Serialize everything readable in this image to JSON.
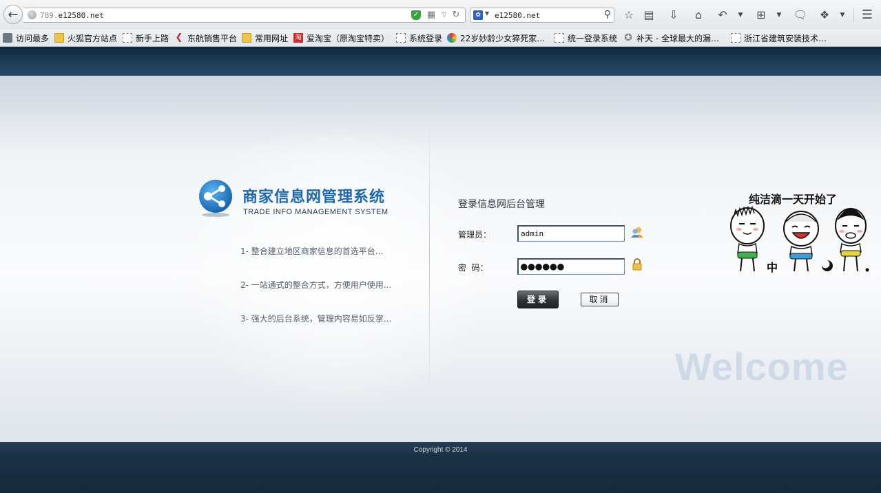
{
  "browser": {
    "url": {
      "host_dim": "789.",
      "host": "e12580.net"
    },
    "search": {
      "engine_icon": "baidu-paw-icon",
      "query": "e12580.net"
    },
    "bookmarks": [
      {
        "label": "访问最多",
        "icon": "most-visited-icon"
      },
      {
        "label": "火狐官方站点",
        "icon": "folder-icon"
      },
      {
        "label": "新手上路",
        "icon": "page-icon"
      },
      {
        "label": "东航销售平台",
        "icon": "airline-icon"
      },
      {
        "label": "常用网址",
        "icon": "folder-icon"
      },
      {
        "label": "爱淘宝（原淘宝特卖）",
        "icon": "taobao-icon"
      },
      {
        "label": "系统登录",
        "icon": "page-icon"
      },
      {
        "label": "22岁妙龄少女猝死家…",
        "icon": "swirl-icon"
      },
      {
        "label": "统一登录系统",
        "icon": "page-icon"
      },
      {
        "label": "补天 - 全球最大的漏…",
        "icon": "star-icon"
      },
      {
        "label": "浙江省建筑安装技术…",
        "icon": "page-icon"
      }
    ]
  },
  "brand": {
    "title": "商家信息网管理系统",
    "subtitle": "TRADE INFO MANAGEMENT SYSTEM"
  },
  "features": [
    "1- 整合建立地区商家信息的首选平台...",
    "2- 一站通式的整合方式，方便用户使用...",
    "3- 强大的后台系统，管理内容易如反掌..."
  ],
  "login": {
    "title": "登录信息网后台管理",
    "username_label": "管理员：",
    "username_value": "admin",
    "password_label": "密  码：",
    "password_value": "●●●●●●",
    "login_button": "登录",
    "cancel_button": "取消"
  },
  "cartoon": {
    "caption": "纯洁滴一天开始了"
  },
  "watermark": "Welcome",
  "footer": {
    "copyright": "Copyright © 2014"
  },
  "colors": {
    "brand_blue": "#1b69b5",
    "header_dark": "#1e3e59",
    "footer_dark": "#1a3144"
  }
}
